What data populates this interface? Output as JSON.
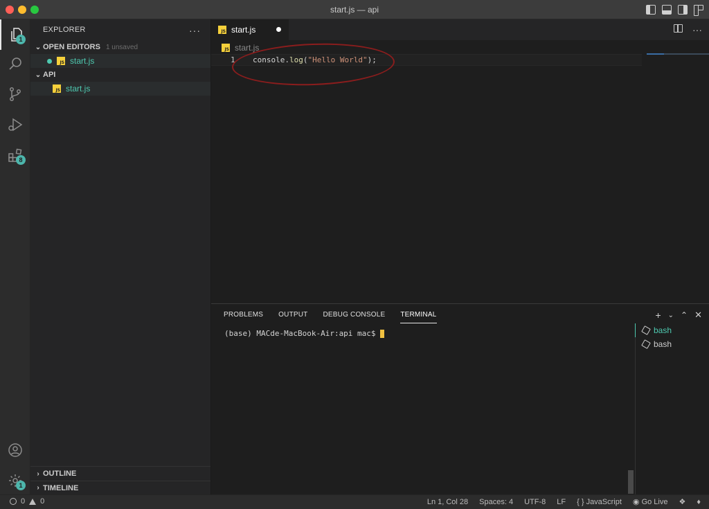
{
  "window": {
    "title": "start.js — api"
  },
  "colors": {
    "accent": "#4ec9b0",
    "annotation_circle": "#8b1d1d",
    "js_icon": "#f5d03b"
  },
  "activity_bar": {
    "explorer_badge": "1",
    "extensions_badge": "8",
    "settings_badge": "1"
  },
  "sidebar": {
    "title": "EXPLORER",
    "more": "···",
    "open_editors": {
      "label": "OPEN EDITORS",
      "status": "1 unsaved",
      "files": [
        "start.js"
      ]
    },
    "folder": {
      "label": "API",
      "files": [
        "start.js"
      ]
    },
    "outline": "OUTLINE",
    "timeline": "TIMELINE"
  },
  "editor": {
    "tab_label": "start.js",
    "breadcrumb": "start.js",
    "line_number": "1",
    "code": {
      "obj": "console",
      "dot": ".",
      "fn": "log",
      "open": "(",
      "str": "\"Hello World\"",
      "close": ");"
    }
  },
  "panel": {
    "tabs": [
      "PROBLEMS",
      "OUTPUT",
      "DEBUG CONSOLE",
      "TERMINAL"
    ],
    "active_tab": "TERMINAL",
    "prompt": "(base) MACde-MacBook-Air:api mac$",
    "terminals": [
      "bash",
      "bash"
    ]
  },
  "statusbar": {
    "errors": "0",
    "warnings": "0",
    "position": "Ln 1, Col 28",
    "spaces": "Spaces: 4",
    "encoding": "UTF-8",
    "eol": "LF",
    "language": "JavaScript",
    "language_icon": "{ }",
    "golive": "Go Live"
  },
  "icons": [
    "files-icon",
    "search-icon",
    "source-control-icon",
    "run-debug-icon",
    "extensions-icon",
    "account-icon",
    "settings-gear-icon",
    "split-editor-icon",
    "more-icon",
    "add-terminal-icon",
    "maximize-panel-icon",
    "close-panel-icon",
    "broadcast-icon",
    "bell-icon"
  ]
}
